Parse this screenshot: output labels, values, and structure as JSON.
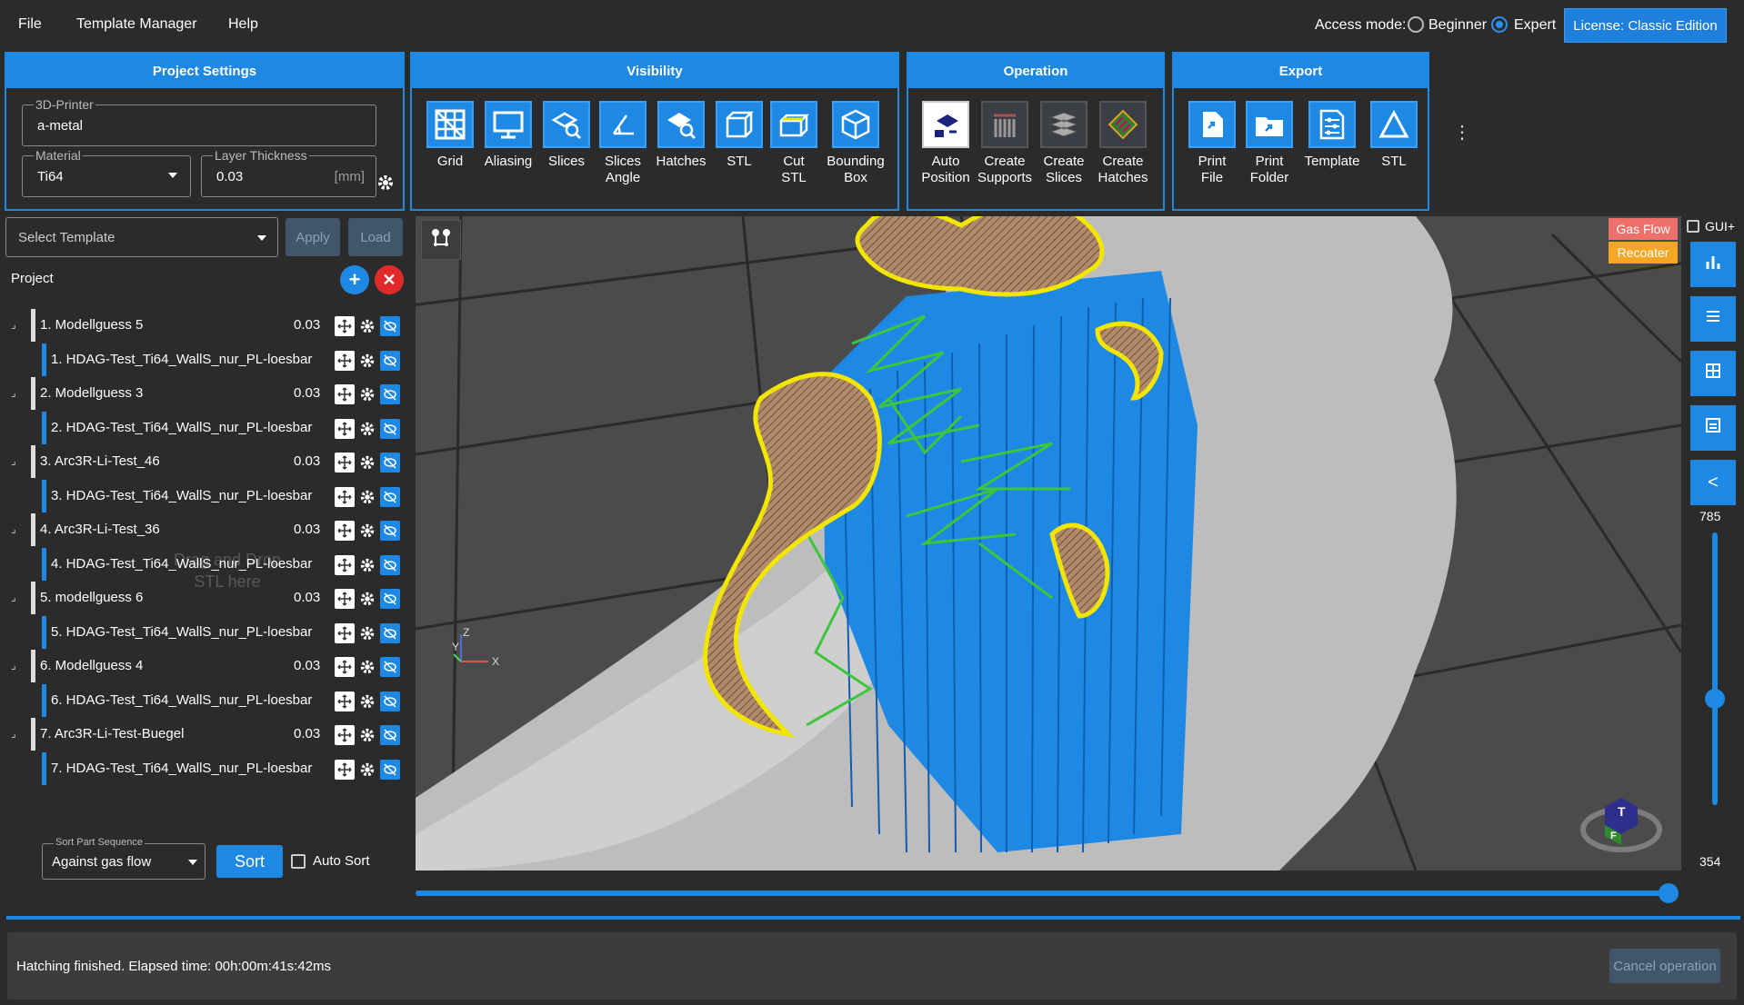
{
  "menu": {
    "file": "File",
    "template_manager": "Template Manager",
    "help": "Help"
  },
  "access": {
    "label": "Access mode:",
    "beginner": "Beginner",
    "expert": "Expert",
    "selected": "Expert"
  },
  "license": "License: Classic Edition",
  "project_settings": {
    "title": "Project Settings",
    "printer_label": "3D-Printer",
    "printer_value": "a-metal",
    "material_label": "Material",
    "material_value": "Ti64",
    "layer_label": "Layer Thickness",
    "layer_value": "0.03",
    "layer_unit": "[mm]"
  },
  "visibility": {
    "title": "Visibility",
    "tools": [
      {
        "l1": "Grid",
        "l2": ""
      },
      {
        "l1": "Aliasing",
        "l2": ""
      },
      {
        "l1": "Slices",
        "l2": ""
      },
      {
        "l1": "Slices",
        "l2": "Angle"
      },
      {
        "l1": "Hatches",
        "l2": ""
      },
      {
        "l1": "STL",
        "l2": ""
      },
      {
        "l1": "Cut",
        "l2": "STL"
      },
      {
        "l1": "Bounding",
        "l2": "Box"
      }
    ]
  },
  "operation": {
    "title": "Operation",
    "tools": [
      {
        "l1": "Auto",
        "l2": "Position"
      },
      {
        "l1": "Create",
        "l2": "Supports"
      },
      {
        "l1": "Create",
        "l2": "Slices"
      },
      {
        "l1": "Create",
        "l2": "Hatches"
      }
    ]
  },
  "export": {
    "title": "Export",
    "tools": [
      {
        "l1": "Print",
        "l2": "File"
      },
      {
        "l1": "Print",
        "l2": "Folder"
      },
      {
        "l1": "Template",
        "l2": ""
      },
      {
        "l1": "STL",
        "l2": ""
      }
    ]
  },
  "template": {
    "placeholder": "Select Template",
    "apply": "Apply",
    "load": "Load"
  },
  "project": {
    "label": "Project",
    "drag_hint_1": "Drag and Drop",
    "drag_hint_2": "STL here",
    "items": [
      {
        "name": "1.  Modellguess 5",
        "value": "0.03",
        "level": 0
      },
      {
        "name": "1.  HDAG-Test_Ti64_WallS_nur_PL-loesbar",
        "value": "",
        "level": 1
      },
      {
        "name": "2.  Modellguess 3",
        "value": "0.03",
        "level": 0
      },
      {
        "name": "2.  HDAG-Test_Ti64_WallS_nur_PL-loesbar",
        "value": "",
        "level": 1
      },
      {
        "name": "3.  Arc3R-Li-Test_46",
        "value": "0.03",
        "level": 0
      },
      {
        "name": "3.  HDAG-Test_Ti64_WallS_nur_PL-loesbar",
        "value": "",
        "level": 1
      },
      {
        "name": "4.  Arc3R-Li-Test_36",
        "value": "0.03",
        "level": 0
      },
      {
        "name": "4.  HDAG-Test_Ti64_WallS_nur_PL-loesbar",
        "value": "",
        "level": 1
      },
      {
        "name": "5.  modellguess 6",
        "value": "0.03",
        "level": 0
      },
      {
        "name": "5.  HDAG-Test_Ti64_WallS_nur_PL-loesbar",
        "value": "",
        "level": 1
      },
      {
        "name": "6.  Modellguess 4",
        "value": "0.03",
        "level": 0
      },
      {
        "name": "6.  HDAG-Test_Ti64_WallS_nur_PL-loesbar",
        "value": "",
        "level": 1
      },
      {
        "name": "7.  Arc3R-Li-Test-Buegel",
        "value": "0.03",
        "level": 0
      },
      {
        "name": "7.  HDAG-Test_Ti64_WallS_nur_PL-loesbar",
        "value": "",
        "level": 1
      }
    ]
  },
  "sort": {
    "label": "Sort Part Sequence",
    "value": "Against gas flow",
    "button": "Sort",
    "auto": "Auto Sort"
  },
  "viewport": {
    "gas_flow": "Gas Flow",
    "recoater": "Recoater",
    "axis_z": "Z",
    "axis_y": "Y",
    "axis_x": "X",
    "cube_top": "T",
    "cube_front": "F"
  },
  "right": {
    "gui_label": "GUI+",
    "collapse": "<",
    "slider_top": "785",
    "slider_bottom": "354"
  },
  "status": {
    "message": "Hatching finished. Elapsed time: 00h:00m:41s:42ms",
    "cancel": "Cancel operation"
  },
  "colors": {
    "accent": "#1e88e5",
    "gas_flow": "#ef6f6c",
    "recoater": "#f5a623",
    "outline": "#f2e600",
    "support": "#2ec22e"
  }
}
